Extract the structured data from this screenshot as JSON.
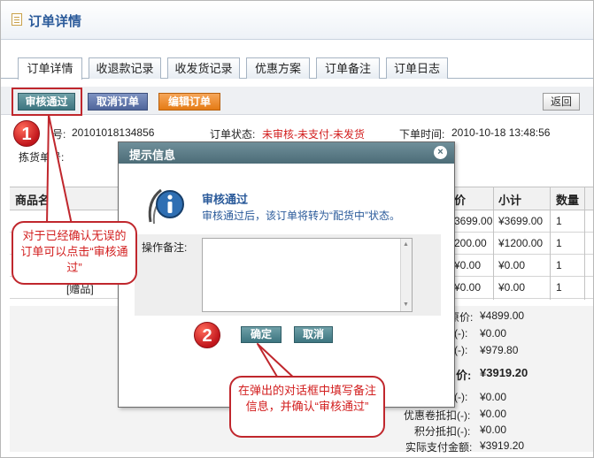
{
  "page": {
    "title": "订单详情"
  },
  "tabs": [
    {
      "label": "订单详情"
    },
    {
      "label": "收退款记录"
    },
    {
      "label": "收发货记录"
    },
    {
      "label": "优惠方案"
    },
    {
      "label": "订单备注"
    },
    {
      "label": "订单日志"
    }
  ],
  "toolbar": {
    "approve_label": "审核通过",
    "cancel_order_label": "取消订单",
    "edit_order_label": "编辑订单",
    "back_label": "返回"
  },
  "order_info": {
    "order_no_label": "号:",
    "order_no": "20101018134856",
    "status_label": "订单状态:",
    "status_value": "未审核-未支付-未发货",
    "time_label": "下单时间:",
    "time_value": "2010-10-18 13:48:56",
    "pick_no_label": "拣货单号:"
  },
  "product_table": {
    "headers": [
      "商品名",
      "价",
      "小计",
      "数量"
    ],
    "rows": [
      {
        "price": "3699.00",
        "subtotal": "¥3699.00",
        "qty": "1"
      },
      {
        "price": "200.00",
        "subtotal": "¥1200.00",
        "qty": "1"
      },
      {
        "price": "¥0.00",
        "subtotal": "¥0.00",
        "qty": "1"
      },
      {
        "price": "¥0.00",
        "subtotal": "¥0.00",
        "qty": "1"
      }
    ],
    "gift_fragment": "[赠品]"
  },
  "totals": {
    "price_label": "原价:",
    "price_value": "¥4899.00",
    "line2_label": "(-):",
    "line2_value": "¥0.00",
    "line3_label": "(-):",
    "line3_value": "¥979.80",
    "final_label": "价:",
    "final_value": "¥3919.20",
    "line5_label": "(-):",
    "line5_value": "¥0.00",
    "coupon_label": "优惠卷抵扣(-):",
    "coupon_value": "¥0.00",
    "points_label": "积分抵扣(-):",
    "points_value": "¥0.00",
    "actual_label": "实际支付金额:",
    "actual_value": "¥3919.20"
  },
  "dialog": {
    "title": "提示信息",
    "close_glyph": "×",
    "message_title": "审核通过",
    "message_body": "审核通过后，该订单将转为“配货中”状态。",
    "remark_label": "操作备注:",
    "confirm_label": "确定",
    "cancel_label": "取消"
  },
  "annotations": {
    "step1_number": "1",
    "step1_text": "对于已经确认无误的订单可以点击“审核通过”",
    "step2_number": "2",
    "step2_text": "在弹出的对话框中填写备注信息，并确认“审核通过”"
  },
  "colors": {
    "accent_blue": "#2a5a9a",
    "status_red": "#d21e1e",
    "annotation_red": "#c0272d",
    "approve_button": "#3d7580",
    "edit_button": "#e57b15"
  }
}
